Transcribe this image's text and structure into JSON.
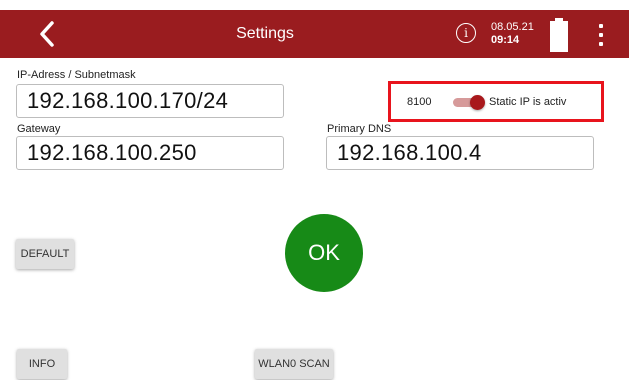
{
  "header": {
    "title": "Settings",
    "date": "08.05.21",
    "time": "09:14",
    "accent_color": "#9a1c1f",
    "icons": [
      "chevron-left-icon",
      "info-icon",
      "battery-icon",
      "more-vert-icon"
    ],
    "info_glyph": "i"
  },
  "ip": {
    "label": "IP-Adress / Subnetmask",
    "value": "192.168.100.170/24"
  },
  "gateway": {
    "label": "Gateway",
    "value": "192.168.100.250"
  },
  "dns": {
    "label": "Primary DNS",
    "value": "192.168.100.4"
  },
  "static_ip": {
    "port": "8100",
    "label": "Static IP is activ",
    "enabled": true,
    "highlight_color": "#e8141d"
  },
  "buttons": {
    "default": "DEFAULT",
    "ok": "OK",
    "info": "INFO",
    "wlan_scan": "WLAN0 SCAN",
    "ok_color": "#178a17"
  }
}
